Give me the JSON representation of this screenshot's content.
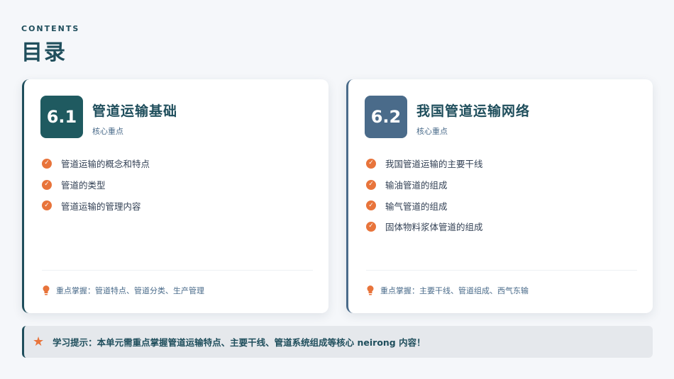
{
  "header": {
    "label": "CONTENTS",
    "title": "目录"
  },
  "cards": [
    {
      "number": "6.1",
      "title": "管道运输基础",
      "subtitle": "核心重点",
      "items": [
        "管道运输的概念和特点",
        "管道的类型",
        "管道运输的管理内容"
      ],
      "footnote": "重点掌握：管道特点、管道分类、生产管理"
    },
    {
      "number": "6.2",
      "title": "我国管道运输网络",
      "subtitle": "核心重点",
      "items": [
        "我国管道运输的主要干线",
        "输油管道的组成",
        "输气管道的组成",
        "固体物料浆体管道的组成"
      ],
      "footnote": "重点掌握：主要干线、管道组成、西气东输"
    }
  ],
  "tip": {
    "text": "学习提示：本单元需重点掌握管道运输特点、主要干线、管道系统组成等核心 neirong 内容！"
  },
  "colors": {
    "primary": "#1f4e5c",
    "secondary": "#4a6b8a",
    "accent": "#e8743b",
    "background": "#f5f7fa"
  },
  "icons": {
    "check": "check-circle-icon",
    "bulb": "lightbulb-icon",
    "star": "star-icon"
  }
}
